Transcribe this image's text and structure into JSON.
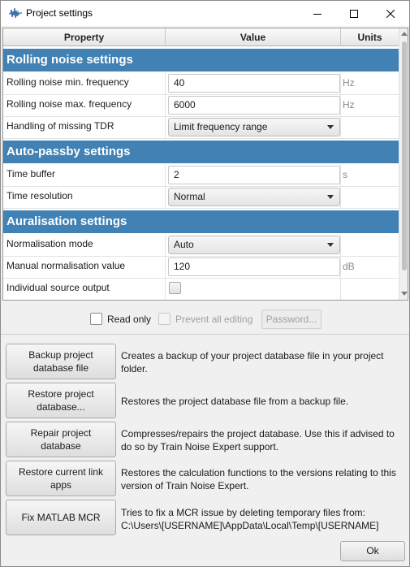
{
  "window": {
    "title": "Project settings",
    "icon": "waveform-icon",
    "controls": [
      "minimize-icon",
      "maximize-icon",
      "close-icon"
    ]
  },
  "table": {
    "headers": {
      "property": "Property",
      "value": "Value",
      "units": "Units"
    },
    "sections": [
      {
        "title": "Rolling noise settings",
        "rows": [
          {
            "property": "Rolling noise min. frequency",
            "type": "text",
            "value": "40",
            "unit": "Hz"
          },
          {
            "property": "Rolling noise max. frequency",
            "type": "text",
            "value": "6000",
            "unit": "Hz"
          },
          {
            "property": "Handling of missing TDR",
            "type": "combo",
            "value": "Limit frequency range",
            "unit": ""
          }
        ]
      },
      {
        "title": "Auto-passby settings",
        "rows": [
          {
            "property": "Time buffer",
            "type": "text",
            "value": "2",
            "unit": "s"
          },
          {
            "property": "Time resolution",
            "type": "combo",
            "value": "Normal",
            "unit": ""
          }
        ]
      },
      {
        "title": "Auralisation settings",
        "rows": [
          {
            "property": "Normalisation mode",
            "type": "combo",
            "value": "Auto",
            "unit": ""
          },
          {
            "property": "Manual normalisation value",
            "type": "text",
            "value": "120",
            "unit": "dB"
          },
          {
            "property": "Individual source output",
            "type": "checkbox",
            "checked": false,
            "unit": ""
          }
        ]
      }
    ]
  },
  "editing": {
    "read_only_label": "Read only",
    "read_only_checked": false,
    "prevent_editing_label": "Prevent all editing",
    "prevent_editing_checked": false,
    "password_label": "Password..."
  },
  "actions": [
    {
      "button_line1": "Backup project",
      "button_line2": "database file",
      "desc_line1": "Creates a backup of your project database file in your project",
      "desc_line2": "folder."
    },
    {
      "button_line1": "Restore project",
      "button_line2": "database...",
      "desc_line1": "Restores the project database file from a backup file.",
      "desc_line2": ""
    },
    {
      "button_line1": "Repair project",
      "button_line2": "database",
      "desc_line1": "Compresses/repairs the project database.  Use this if advised to",
      "desc_line2": "do so by Train Noise Expert support."
    },
    {
      "button_line1": "Restore current link",
      "button_line2": "apps",
      "desc_line1": "Restores the calculation functions to the versions relating to this",
      "desc_line2": "version of Train Noise Expert."
    },
    {
      "button_line1": "Fix MATLAB MCR",
      "button_line2": "",
      "desc_line1": "Tries to fix a MCR issue by deleting temporary files from:",
      "desc_line2": "C:\\Users\\[USERNAME]\\AppData\\Local\\Temp\\[USERNAME]"
    }
  ],
  "ok_label": "Ok",
  "colors": {
    "section_header": "#4181b3",
    "window_bg": "#f0f0f0"
  }
}
